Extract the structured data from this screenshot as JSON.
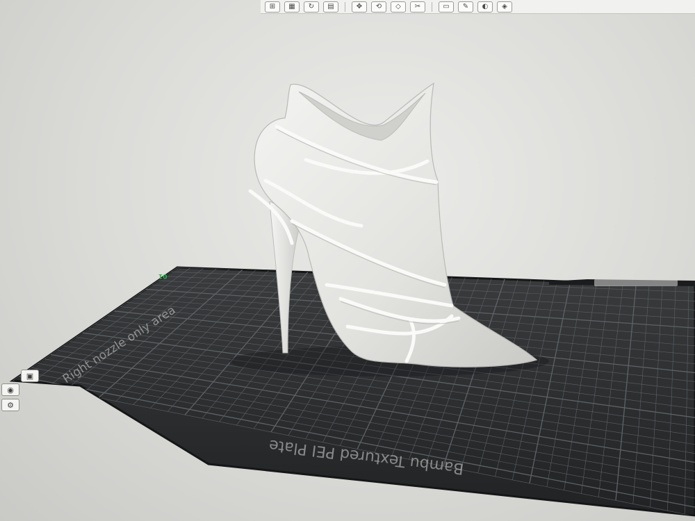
{
  "viewport": {
    "plate_name_label": "Bambu Textured PEI Plate",
    "nozzle_label": "Right nozzle only area",
    "plate_number_label": "01"
  },
  "toolbar": {
    "buttons": [
      {
        "icon": "add-object-icon",
        "glyph": "⊞"
      },
      {
        "icon": "arrange-grid-icon",
        "glyph": "▦"
      },
      {
        "icon": "auto-orient-icon",
        "glyph": "↻"
      },
      {
        "icon": "plate-icon",
        "glyph": "▤"
      },
      {
        "icon": "move-icon",
        "glyph": "✥"
      },
      {
        "icon": "rotate-icon",
        "glyph": "⟲"
      },
      {
        "icon": "scale-icon",
        "glyph": "◇"
      },
      {
        "icon": "cut-icon",
        "glyph": "✂"
      },
      {
        "icon": "place-on-face-icon",
        "glyph": "▭"
      },
      {
        "icon": "support-paint-icon",
        "glyph": "✎"
      },
      {
        "icon": "seam-paint-icon",
        "glyph": "◐"
      },
      {
        "icon": "color-paint-icon",
        "glyph": "◈"
      }
    ]
  },
  "left_tools": {
    "buttons": [
      {
        "icon": "layers-view-icon",
        "glyph": "▣"
      },
      {
        "icon": "camera-view-icon",
        "glyph": "◉"
      },
      {
        "icon": "settings-icon",
        "glyph": "⚙"
      }
    ]
  },
  "colors": {
    "background": "#dadad7",
    "plate_surface": "#2b2d2f",
    "plate_grid": "#5f6366",
    "model": "#e6e6e3",
    "plate_label_green": "#2bb24c"
  }
}
